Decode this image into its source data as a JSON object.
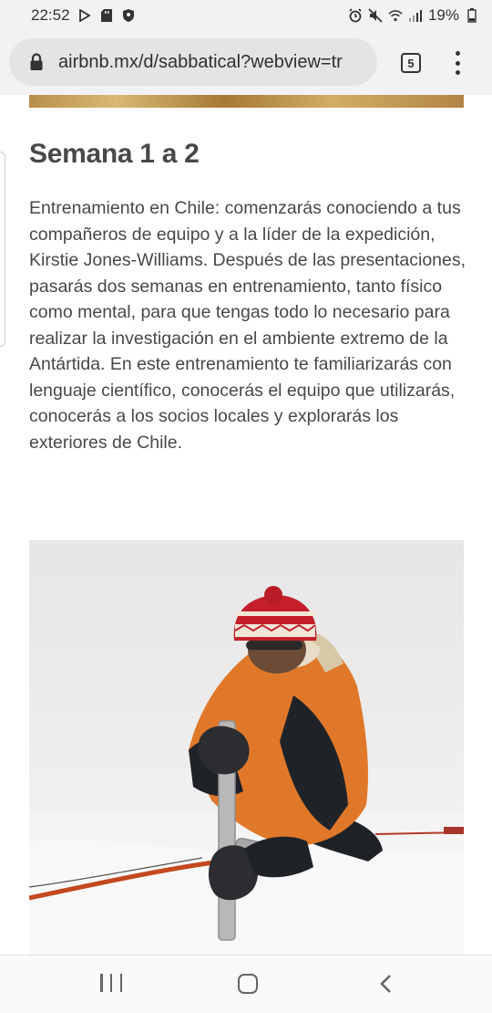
{
  "status_bar": {
    "time": "22:52",
    "battery": "19%",
    "left_icons": [
      "play-store-icon",
      "sd-card-icon",
      "shield-icon"
    ],
    "right_icons": [
      "alarm-icon",
      "mute-icon",
      "wifi-icon",
      "signal-icon",
      "battery-icon"
    ]
  },
  "browser": {
    "url": "airbnb.mx/d/sabbatical?webview=tr",
    "tab_count": "5",
    "icons": [
      "lock-icon",
      "tabs-icon",
      "menu-icon"
    ]
  },
  "article": {
    "heading": "Semana 1 a 2",
    "paragraph": "Entrenamiento en Chile: comenzarás conociendo a tus compañeros de equipo y a la líder de la expedición, Kirstie Jones-Williams. Después de las presentaciones, pasarás dos semanas en entrenamiento, tanto físico como mental, para que tengas todo lo necesario para realizar la investigación en el ambiente extremo de la Antártida. En este entrenamiento te familiarizarás con lenguaje científico, conocerás el equipo que utilizarás, conocerás a los socios locales y explorarás los exteriores de Chile.",
    "photo": "man-drilling-ice-core-in-snow"
  },
  "nav_bar": {
    "icons": [
      "recents-icon",
      "home-icon",
      "back-icon"
    ]
  },
  "colors": {
    "text": "#484848",
    "status_bg": "#f2f2f2",
    "url_pill": "#e4e4e4",
    "jacket_orange": "#e0782a",
    "hat_red": "#c41f2a"
  }
}
